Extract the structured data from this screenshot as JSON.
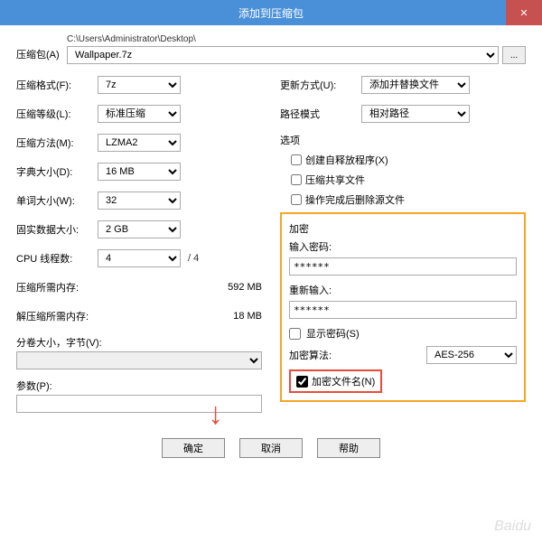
{
  "titlebar": {
    "title": "添加到压缩包"
  },
  "path": {
    "label": "压缩包(A)",
    "dir": "C:\\Users\\Administrator\\Desktop\\",
    "file": "Wallpaper.7z",
    "browse": "..."
  },
  "left": {
    "format_label": "压缩格式(F):",
    "format_value": "7z",
    "level_label": "压缩等级(L):",
    "level_value": "标准压缩",
    "method_label": "压缩方法(M):",
    "method_value": "LZMA2",
    "dict_label": "字典大小(D):",
    "dict_value": "16 MB",
    "word_label": "单词大小(W):",
    "word_value": "32",
    "solid_label": "固实数据大小:",
    "solid_value": "2 GB",
    "cpu_label": "CPU 线程数:",
    "cpu_value": "4",
    "cpu_suffix": "/ 4",
    "mem_compress_label": "压缩所需内存:",
    "mem_compress_value": "592 MB",
    "mem_decompress_label": "解压缩所需内存:",
    "mem_decompress_value": "18 MB",
    "split_label": "分卷大小，字节(V):",
    "params_label": "参数(P):"
  },
  "right": {
    "update_label": "更新方式(U):",
    "update_value": "添加并替换文件",
    "pathmode_label": "路径模式",
    "pathmode_value": "相对路径",
    "options_title": "选项",
    "opt_sfx": "创建自释放程序(X)",
    "opt_share": "压缩共享文件",
    "opt_delete": "操作完成后删除源文件",
    "enc_title": "加密",
    "enc_pwd_label": "输入密码:",
    "enc_pwd_value": "******",
    "enc_repwd_label": "重新输入:",
    "enc_repwd_value": "******",
    "enc_show": "显示密码(S)",
    "enc_algo_label": "加密算法:",
    "enc_algo_value": "AES-256",
    "enc_names": "加密文件名(N)"
  },
  "footer": {
    "ok": "确定",
    "cancel": "取消",
    "help": "帮助"
  },
  "watermark": "Baidu"
}
